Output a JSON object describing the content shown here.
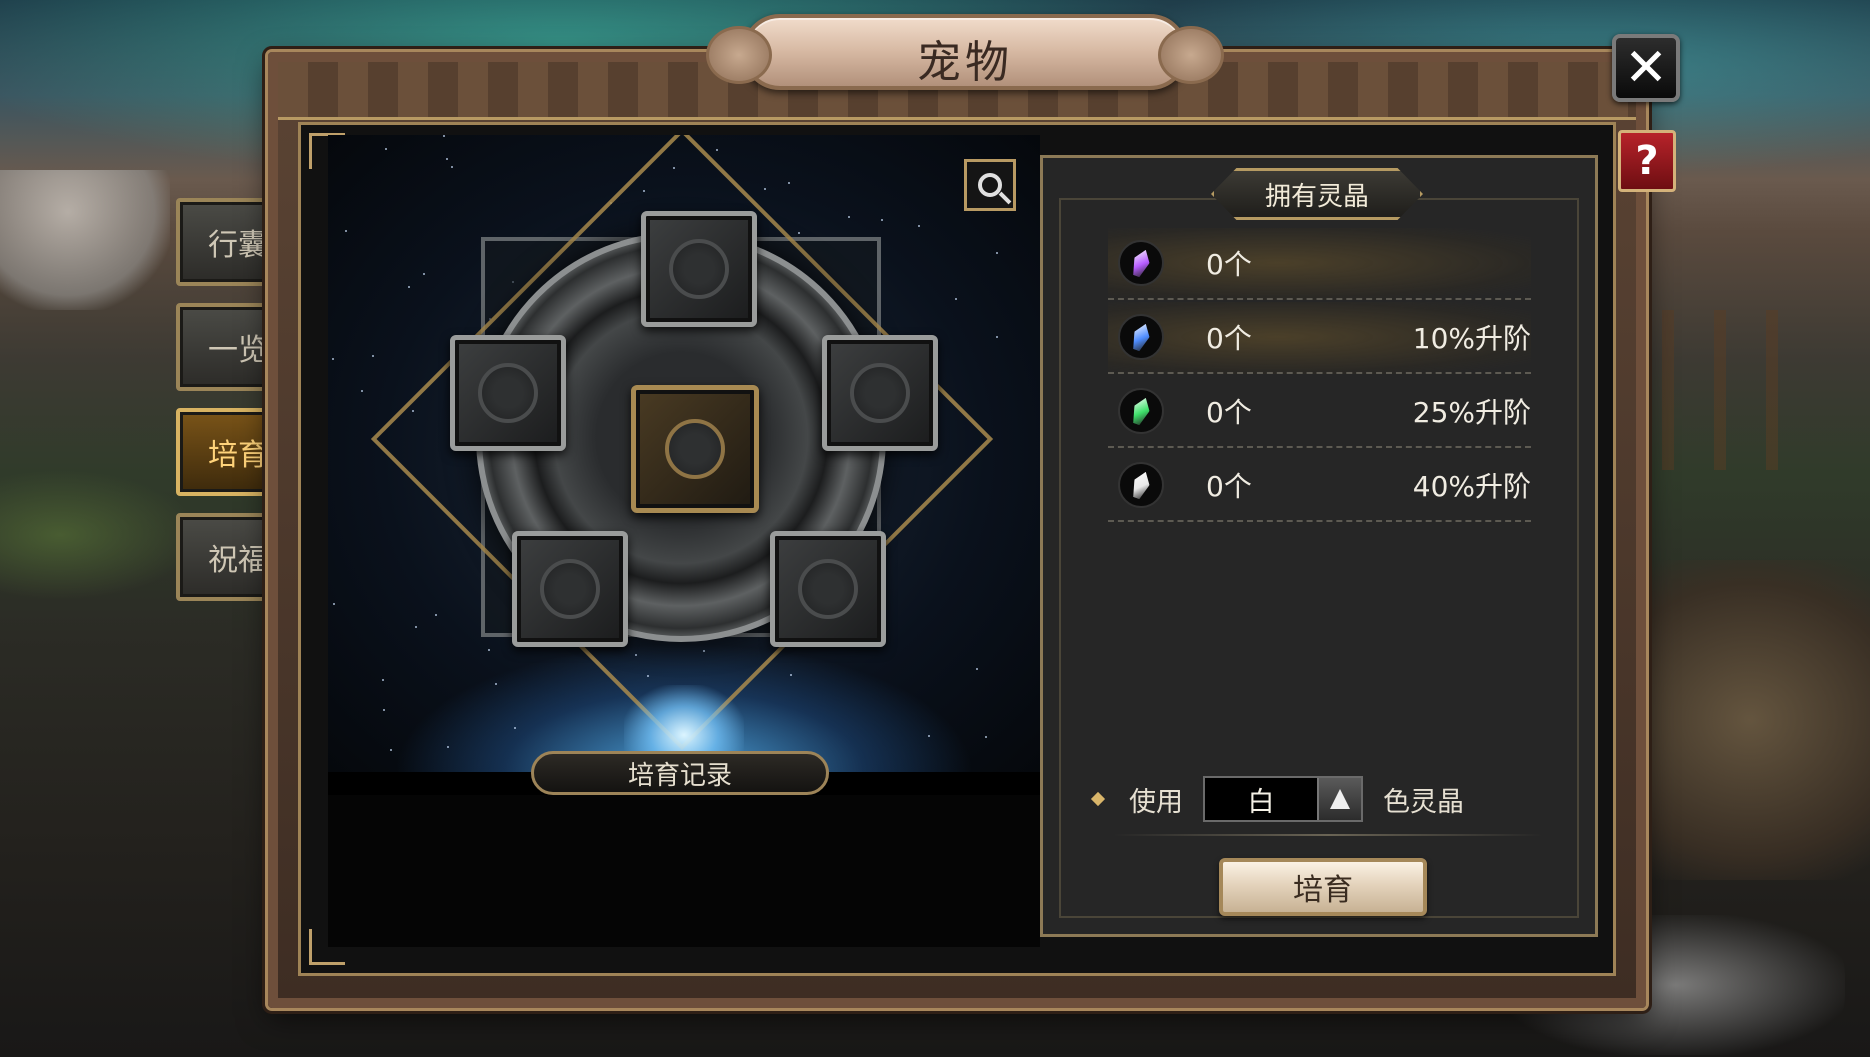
{
  "window": {
    "title": "宠物"
  },
  "controls": {
    "close_symbol": "✕",
    "help_symbol": "?"
  },
  "tabs": [
    {
      "label": "行囊",
      "active": false
    },
    {
      "label": "一览",
      "active": false
    },
    {
      "label": "培育",
      "active": true
    },
    {
      "label": "祝福",
      "active": false
    }
  ],
  "left_panel": {
    "record_label": "培育记录",
    "zoom_icon": "magnifier-icon"
  },
  "right_panel": {
    "header": "拥有灵晶",
    "crystals": [
      {
        "count": "0个",
        "bonus": "",
        "color": "#b65cff"
      },
      {
        "count": "0个",
        "bonus": "10%升阶",
        "color": "#4f8dff"
      },
      {
        "count": "0个",
        "bonus": "25%升阶",
        "color": "#3ee06a"
      },
      {
        "count": "0个",
        "bonus": "40%升阶",
        "color": "#e8e8e8"
      }
    ],
    "use_prefix": "使用",
    "selected_color": "白",
    "use_suffix": "色灵晶",
    "nurture_button": "培育"
  }
}
